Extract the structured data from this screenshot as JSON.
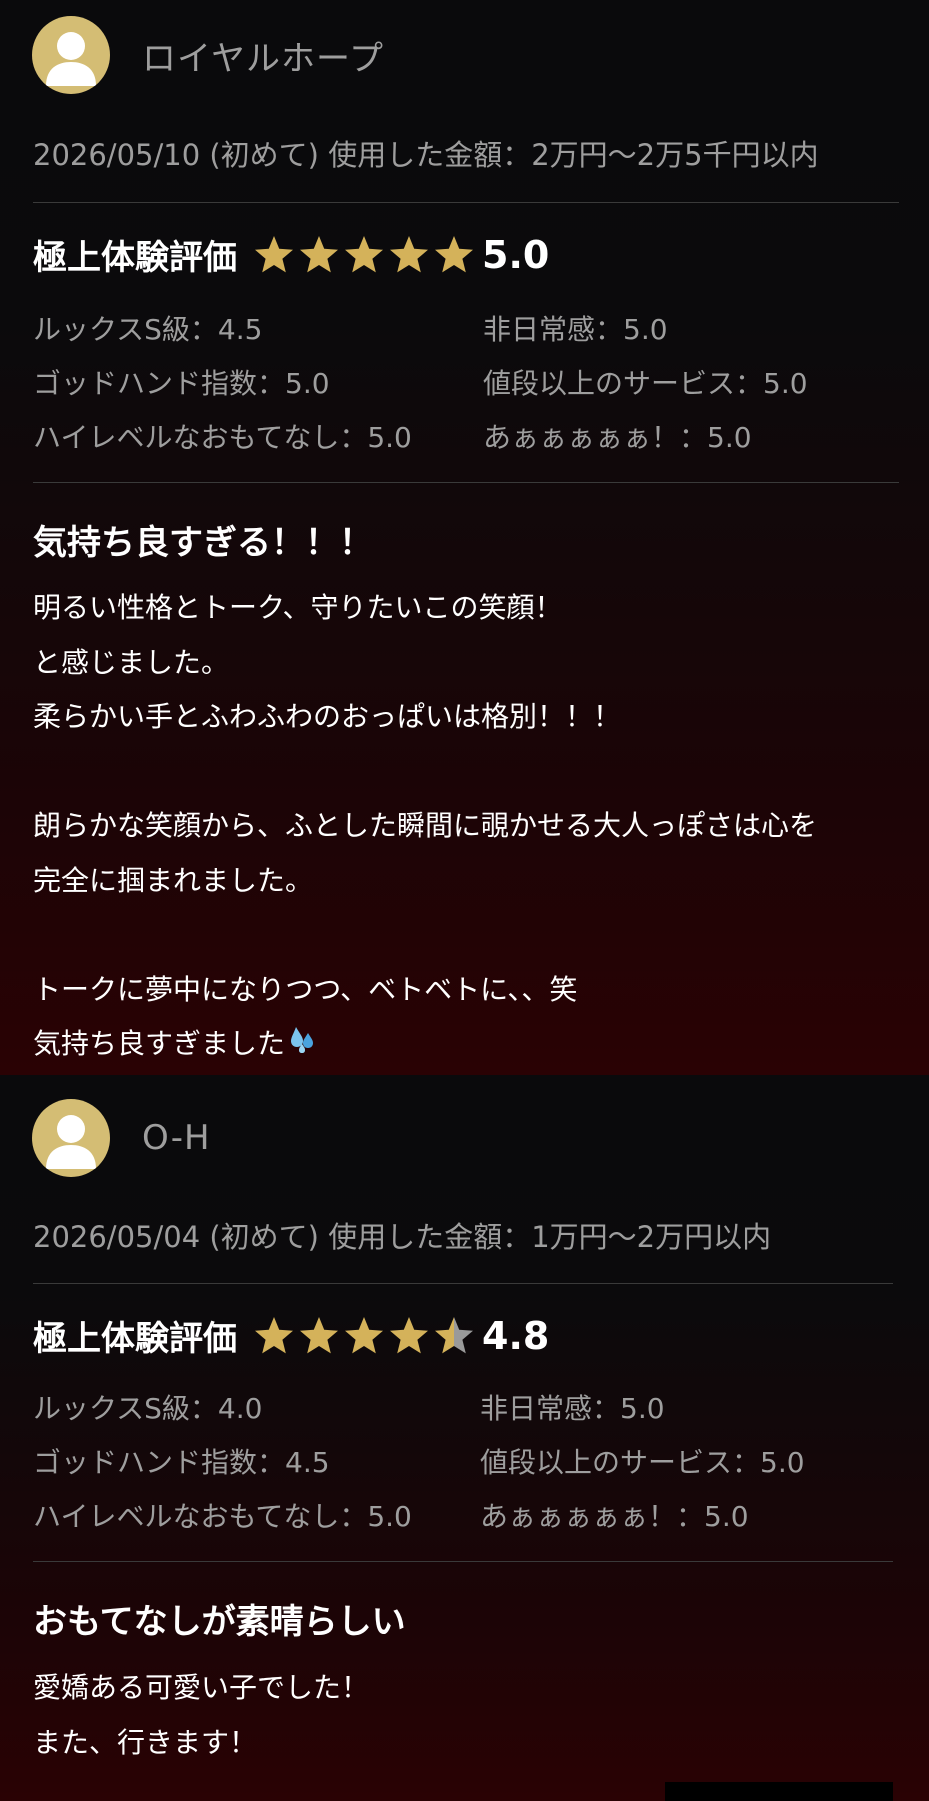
{
  "reviews": [
    {
      "reviewer": "ロイヤルホープ",
      "meta": "2026/05/10 (初めて) 使用した金額：2万円〜2万5千円以内",
      "rating_label": "極上体験評価",
      "rating_score": "5.0",
      "stars": [
        1,
        1,
        1,
        1,
        1
      ],
      "subratings": [
        "ルックスS級：4.5",
        "非日常感：5.0",
        "ゴッドハンド指数：5.0",
        "値段以上のサービス：5.0",
        "ハイレベルなおもてなし：5.0",
        "あぁぁぁぁぁ！：5.0"
      ],
      "headline": "気持ち良すぎる！！！",
      "body": [
        "明るい性格とトーク、守りたいこの笑顔！",
        "と感じました。",
        "柔らかい手とふわふわのおっぱいは格別！！！",
        "",
        "朗らかな笑顔から、ふとした瞬間に覗かせる大人っぽさは心を",
        "完全に掴まれました。",
        "",
        "トークに夢中になりつつ、ベトベトに、、笑",
        "気持ち良すぎました"
      ],
      "body_emoji": "droplets-icon"
    },
    {
      "reviewer": "O-H",
      "meta": "2026/05/04 (初めて) 使用した金額：1万円〜2万円以内",
      "rating_label": "極上体験評価",
      "rating_score": "4.8",
      "stars": [
        1,
        1,
        1,
        1,
        0.5
      ],
      "subratings": [
        "ルックスS級：4.0",
        "非日常感：5.0",
        "ゴッドハンド指数：4.5",
        "値段以上のサービス：5.0",
        "ハイレベルなおもてなし：5.0",
        "あぁぁぁぁぁ！：5.0"
      ],
      "headline": "おもてなしが素晴らしい",
      "body": [
        "愛嬌ある可愛い子でした！",
        "また、行きます！"
      ]
    }
  ],
  "colors": {
    "star_gold": "#d4b25a",
    "star_empty": "#9a9a9a",
    "avatar_bg": "#d4bd74",
    "muted_text": "#9e9e9e"
  }
}
